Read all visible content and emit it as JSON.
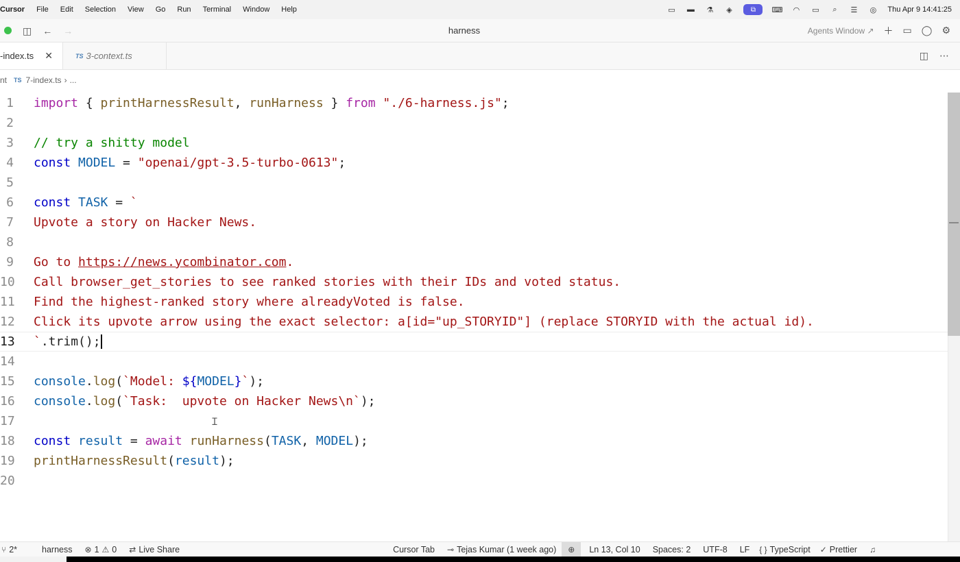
{
  "menubar": {
    "app": "Cursor",
    "items": [
      "File",
      "Edit",
      "Selection",
      "View",
      "Go",
      "Run",
      "Terminal",
      "Window",
      "Help"
    ],
    "clock": "Thu Apr 9  14:41:25"
  },
  "titlebar": {
    "title": "harness",
    "agents_window": "Agents Window ↗"
  },
  "tabs": [
    {
      "label": "-index.ts",
      "active": true
    },
    {
      "label": "3-context.ts",
      "active": false,
      "lang": "TS"
    }
  ],
  "breadcrumb": {
    "parent": "nt",
    "lang": "TS",
    "file": "7-index.ts",
    "rest": "..."
  },
  "editor": {
    "current_line": 13,
    "lines": [
      {
        "n": "1"
      },
      {
        "n": "2"
      },
      {
        "n": "3"
      },
      {
        "n": "4"
      },
      {
        "n": "5"
      },
      {
        "n": "6"
      },
      {
        "n": "7"
      },
      {
        "n": "8"
      },
      {
        "n": "9"
      },
      {
        "n": "10"
      },
      {
        "n": "11"
      },
      {
        "n": "12"
      },
      {
        "n": "13"
      },
      {
        "n": "14"
      },
      {
        "n": "15"
      },
      {
        "n": "16"
      },
      {
        "n": "17"
      },
      {
        "n": "18"
      },
      {
        "n": "19"
      },
      {
        "n": "20"
      }
    ],
    "code": {
      "l1": {
        "kw_import": "import",
        "brace_open": " { ",
        "id1": "printHarnessResult",
        "comma": ", ",
        "id2": "runHarness",
        "brace_close": " } ",
        "kw_from": "from",
        "sp": " ",
        "path": "\"./6-harness.js\"",
        "semi": ";"
      },
      "l3": {
        "comment": "// try a shitty model"
      },
      "l4": {
        "kw": "const",
        "name": " MODEL",
        "eq": " = ",
        "value": "\"openai/gpt-3.5-turbo-0613\"",
        "semi": ";"
      },
      "l6": {
        "kw": "const",
        "name": " TASK",
        "eq": " = ",
        "tick": "`"
      },
      "l7": "Upvote a story on Hacker News.",
      "l9_pre": "Go to ",
      "l9_url": "https://news.ycombinator.com",
      "l9_post": ".",
      "l10": "Call browser_get_stories to see ranked stories with their IDs and voted status.",
      "l11": "Find the highest-ranked story where alreadyVoted is false.",
      "l12": "Click its upvote arrow using the exact selector: a[id=\"up_STORYID\"] (replace STORYID with the actual id).",
      "l13": {
        "tick": "`",
        "rest": ".trim();"
      },
      "l15": {
        "obj": "console",
        "dot": ".",
        "fn": "log",
        "paren": "(",
        "s1": "`Model: ",
        "interp_open": "${",
        "var": "MODEL",
        "interp_close": "}",
        "s2": "`",
        "end": ");"
      },
      "l16": {
        "obj": "console",
        "dot": ".",
        "fn": "log",
        "paren": "(",
        "s1": "`Task:  upvote on Hacker News\\n`",
        "end": ");"
      },
      "l18": {
        "kw": "const",
        "sp": " ",
        "var": "result",
        "eq": " = ",
        "kw_await": "await",
        "sp2": " ",
        "fn": "runHarness",
        "p1": "(",
        "a1": "TASK",
        "c": ", ",
        "a2": "MODEL",
        "end": ");"
      },
      "l19": {
        "fn": "printHarnessResult",
        "p1": "(",
        "arg": "result",
        "end": ");"
      }
    }
  },
  "statusbar": {
    "branch": "2*",
    "project": "harness",
    "errors": "1",
    "warnings": "0",
    "live_share": "Live Share",
    "cursor_tab": "Cursor Tab",
    "blame": "Tejas Kumar (1 week ago)",
    "position": "Ln 13, Col 10",
    "spaces": "Spaces: 2",
    "encoding": "UTF-8",
    "eol": "LF",
    "language_braces": "{ }",
    "language": "TypeScript",
    "formatter": "Prettier"
  }
}
